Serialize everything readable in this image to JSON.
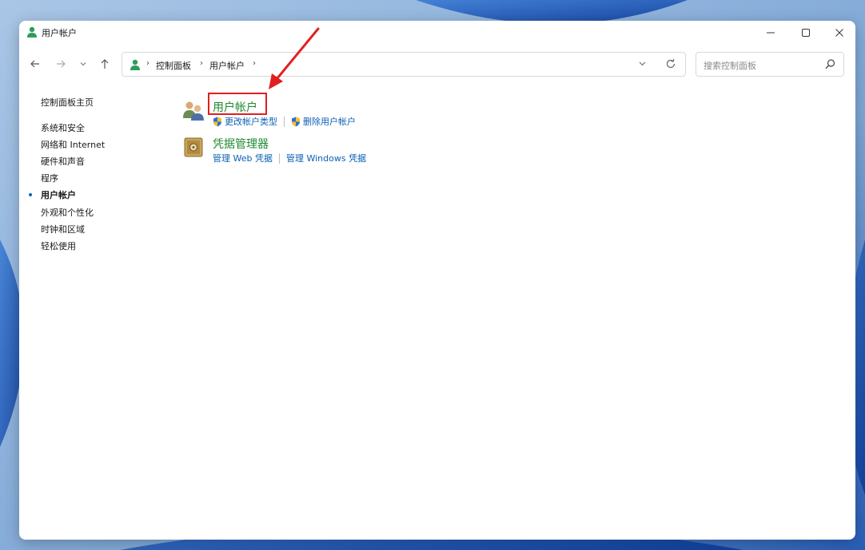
{
  "window": {
    "title": "用户帐户",
    "controls": {
      "minimize": "–",
      "maximize": "☐",
      "close": "✕"
    }
  },
  "nav": {
    "back_icon": "arrow-left-icon",
    "forward_icon": "arrow-right-icon",
    "recent_icon": "chevron-down-icon",
    "up_icon": "arrow-up-icon",
    "breadcrumb": [
      "控制面板",
      "用户帐户"
    ],
    "dropdown_icon": "chevron-down-icon",
    "refresh_icon": "refresh-icon"
  },
  "search": {
    "placeholder": "搜索控制面板",
    "icon": "search-icon"
  },
  "sidebar": {
    "home": "控制面板主页",
    "items": [
      {
        "label": "系统和安全",
        "active": false
      },
      {
        "label": "网络和 Internet",
        "active": false
      },
      {
        "label": "硬件和声音",
        "active": false
      },
      {
        "label": "程序",
        "active": false
      },
      {
        "label": "用户帐户",
        "active": true
      },
      {
        "label": "外观和个性化",
        "active": false
      },
      {
        "label": "时钟和区域",
        "active": false
      },
      {
        "label": "轻松使用",
        "active": false
      }
    ]
  },
  "main": {
    "categories": [
      {
        "title": "用户帐户",
        "icon": "users-icon",
        "links": [
          {
            "label": "更改帐户类型",
            "icon": "shield-icon"
          },
          {
            "label": "删除用户帐户",
            "icon": "shield-icon"
          }
        ]
      },
      {
        "title": "凭据管理器",
        "icon": "safe-icon",
        "links": [
          {
            "label": "管理 Web 凭据"
          },
          {
            "label": "管理 Windows 凭据"
          }
        ]
      }
    ]
  },
  "colors": {
    "category_title": "#1e8a2e",
    "link": "#0a60b4",
    "annotation": "#e02020",
    "accent": "#0067c0"
  }
}
